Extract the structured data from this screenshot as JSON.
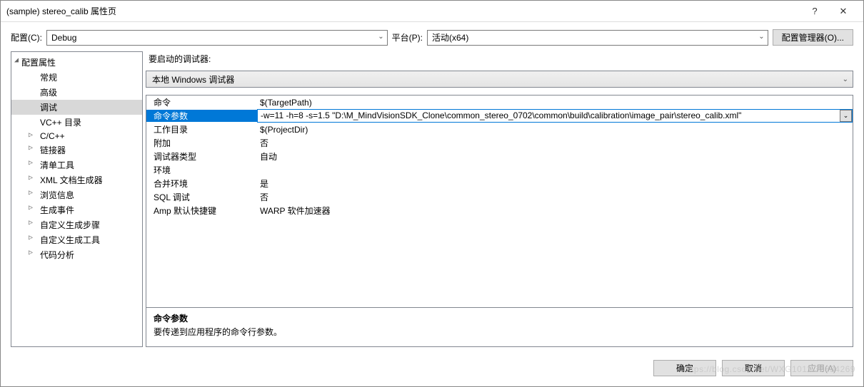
{
  "window": {
    "title": "(sample) stereo_calib 属性页",
    "help_icon": "?",
    "close_icon": "✕"
  },
  "toolbar": {
    "config_label": "配置(C):",
    "config_value": "Debug",
    "platform_label": "平台(P):",
    "platform_value": "活动(x64)",
    "config_manager_label": "配置管理器(O)..."
  },
  "tree": {
    "root": "配置属性",
    "items": [
      {
        "label": "常规",
        "type": "leaf"
      },
      {
        "label": "高级",
        "type": "leaf"
      },
      {
        "label": "调试",
        "type": "leaf",
        "selected": true
      },
      {
        "label": "VC++ 目录",
        "type": "leaf"
      },
      {
        "label": "C/C++",
        "type": "branch"
      },
      {
        "label": "链接器",
        "type": "branch"
      },
      {
        "label": "清单工具",
        "type": "branch"
      },
      {
        "label": "XML 文档生成器",
        "type": "branch"
      },
      {
        "label": "浏览信息",
        "type": "branch"
      },
      {
        "label": "生成事件",
        "type": "branch"
      },
      {
        "label": "自定义生成步骤",
        "type": "branch"
      },
      {
        "label": "自定义生成工具",
        "type": "branch"
      },
      {
        "label": "代码分析",
        "type": "branch"
      }
    ]
  },
  "right": {
    "section_label": "要启动的调试器:",
    "debugger_value": "本地 Windows 调试器",
    "grid": [
      {
        "name": "命令",
        "value": "$(TargetPath)"
      },
      {
        "name": "命令参数",
        "value": "-w=11 -h=8 -s=1.5  \"D:\\M_MindVisionSDK_Clone\\common_stereo_0702\\common\\build\\calibration\\image_pair\\stereo_calib.xml\"",
        "selected": true
      },
      {
        "name": "工作目录",
        "value": "$(ProjectDir)"
      },
      {
        "name": "附加",
        "value": "否"
      },
      {
        "name": "调试器类型",
        "value": "自动"
      },
      {
        "name": "环境",
        "value": ""
      },
      {
        "name": "合并环境",
        "value": "是"
      },
      {
        "name": "SQL 调试",
        "value": "否"
      },
      {
        "name": "Amp 默认快捷键",
        "value": "WARP 软件加速器"
      }
    ],
    "description": {
      "title": "命令参数",
      "text": "要传递到应用程序的命令行参数。"
    }
  },
  "footer": {
    "ok": "确定",
    "cancel": "取消",
    "apply": "应用(A)"
  },
  "watermark": "https://blog.csdn.net/WXG1011 37834269"
}
